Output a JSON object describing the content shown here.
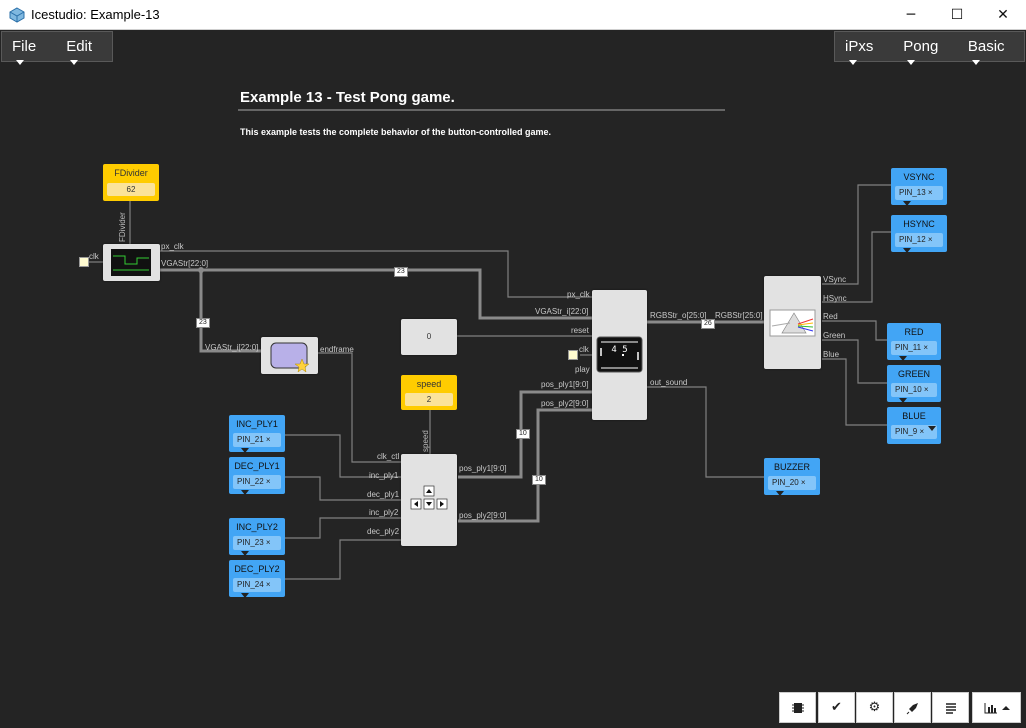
{
  "window": {
    "title": "Icestudio: Example-13",
    "minimize": "─",
    "maximize": "☐",
    "close": "✕"
  },
  "menu_left": [
    {
      "label": "File"
    },
    {
      "label": "Edit"
    }
  ],
  "menu_right": [
    {
      "label": "iPxs"
    },
    {
      "label": "Pong"
    },
    {
      "label": "Basic"
    }
  ],
  "doc": {
    "title": "Example 13 - Test Pong game.",
    "description": "This example tests the complete behavior of the button-controlled game."
  },
  "fdivider": {
    "label": "FDivider",
    "value": "62",
    "vertical_label": "FDivider"
  },
  "speed": {
    "label": "speed",
    "value": "2",
    "vertical_label": "speed"
  },
  "zero_block": {
    "value": "0"
  },
  "inputs": [
    {
      "label": "INC_PLY1",
      "pin": "PIN_21 ×"
    },
    {
      "label": "DEC_PLY1",
      "pin": "PIN_22 ×"
    },
    {
      "label": "INC_PLY2",
      "pin": "PIN_23 ×"
    },
    {
      "label": "DEC_PLY2",
      "pin": "PIN_24 ×"
    }
  ],
  "outputs": [
    {
      "label": "VSYNC",
      "pin": "PIN_13 ×"
    },
    {
      "label": "HSYNC",
      "pin": "PIN_12 ×"
    },
    {
      "label": "RED",
      "pin": "PIN_11 ×"
    },
    {
      "label": "GREEN",
      "pin": "PIN_10 ×"
    },
    {
      "label": "BLUE",
      "pin": "PIN_9   ×"
    },
    {
      "label": "BUZZER",
      "pin": "PIN_20 ×"
    }
  ],
  "ports": {
    "clk": "clk",
    "px_clk": "px_clk",
    "vgastr": "VGAStr[22:0]",
    "vgastr_i": "VGAStr_i[22:0]",
    "endframe": "endframe",
    "game_px_clk": "px_clk",
    "game_vgastr_i": "VGAStr_i[22:0]",
    "reset": "reset",
    "game_clk": "clk",
    "play": "play",
    "pos_ply1_in": "pos_ply1[9:0]",
    "pos_ply2_in": "pos_ply2[9:0]",
    "rgbstr_o": "RGBStr_o[25:0]",
    "out_sound": "out_sound",
    "rgbstr": "RGBStr[25:0]",
    "vsync": "VSync",
    "hsync": "HSync",
    "red": "Red",
    "green": "Green",
    "blue": "Blue",
    "clk_ctl": "clk_ctl",
    "inc_ply1": "inc_ply1",
    "dec_ply1": "dec_ply1",
    "inc_ply2": "inc_ply2",
    "dec_ply2": "dec_ply2",
    "pos_ply1_out": "pos_ply1[9:0]",
    "pos_ply2_out": "pos_ply2[9:0]"
  },
  "bus_widths": {
    "vga_main": "23",
    "vga_branch": "23",
    "rgb": "26",
    "pos1": "10",
    "pos2": "10"
  },
  "pong_score": "4 5",
  "toolbar": {
    "icons": [
      "chip-icon",
      "check-icon",
      "gear-icon",
      "rocket-icon",
      "list-icon",
      "chart-icon"
    ]
  },
  "colors": {
    "canvas": "#242424",
    "input_pin": "#42a5f5",
    "constant": "#ffcc00",
    "block": "#e2e2e2",
    "wire": "#888888"
  }
}
